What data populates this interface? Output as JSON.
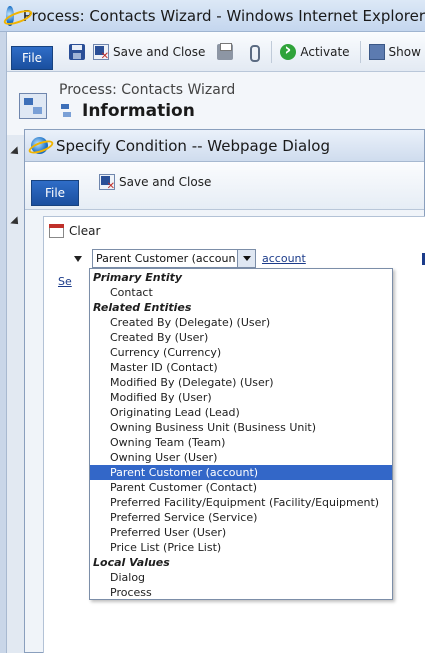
{
  "outer_window": {
    "title": "Process: Contacts Wizard - Windows Internet Explorer",
    "icon": "ie-icon"
  },
  "outer_ribbon": {
    "file_label": "File",
    "save_close_label": "Save and Close",
    "activate_label": "Activate",
    "show_label": "Show"
  },
  "outer_header": {
    "process_title": "Process: Contacts Wizard",
    "section_title": "Information"
  },
  "dialog": {
    "title": "Specify Condition -- Webpage Dialog",
    "file_label": "File",
    "save_close_label": "Save and Close",
    "clear_label": "Clear",
    "selected_entity": "Parent Customer (account)",
    "entity_link": "account",
    "se_link": "Se"
  },
  "dropdown": {
    "groups": [
      {
        "label": "Primary Entity",
        "items": [
          "Contact"
        ]
      },
      {
        "label": "Related Entities",
        "items": [
          "Created By (Delegate) (User)",
          "Created By (User)",
          "Currency (Currency)",
          "Master ID (Contact)",
          "Modified By (Delegate) (User)",
          "Modified By (User)",
          "Originating Lead (Lead)",
          "Owning Business Unit (Business Unit)",
          "Owning Team (Team)",
          "Owning User (User)",
          "Parent Customer (account)",
          "Parent Customer (Contact)",
          "Preferred Facility/Equipment (Facility/Equipment)",
          "Preferred Service (Service)",
          "Preferred User (User)",
          "Price List (Price List)"
        ]
      },
      {
        "label": "Local Values",
        "items": [
          "Dialog",
          "Process"
        ]
      }
    ],
    "selected_item": "Parent Customer (account)"
  }
}
